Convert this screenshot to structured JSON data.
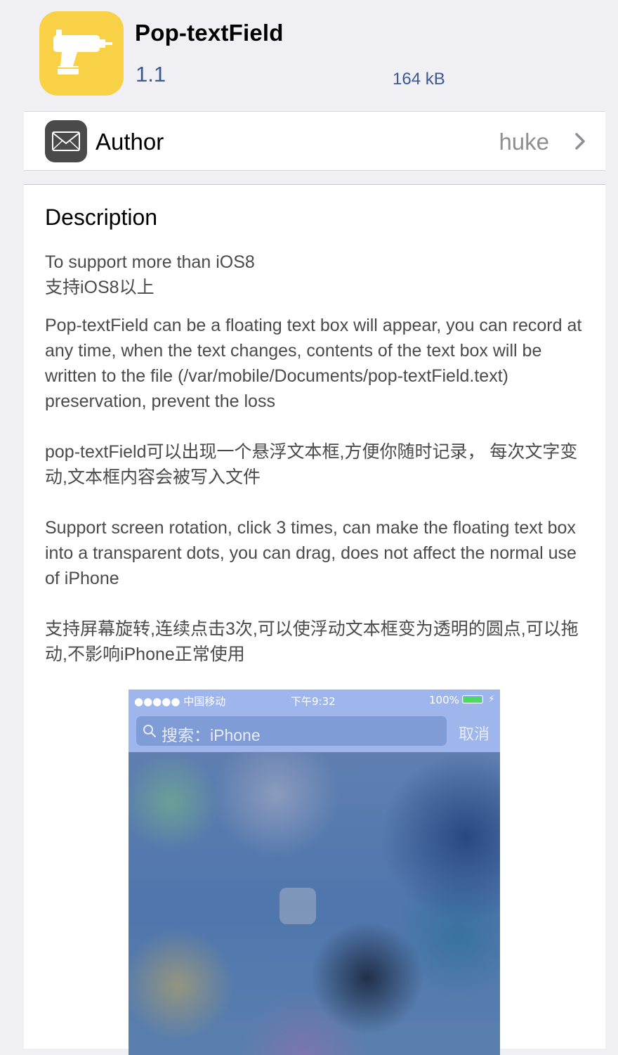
{
  "app": {
    "title": "Pop-textField",
    "version": "1.1",
    "size": "164 kB",
    "icon": "drill-icon",
    "icon_color": "#f9d147"
  },
  "author_row": {
    "label": "Author",
    "value": "huke",
    "icon": "mail-icon",
    "chevron": "chevron-right-icon"
  },
  "description": {
    "heading": "Description",
    "paragraphs": [
      "To support more than iOS8\n支持iOS8以上",
      "Pop-textField can be a floating text box will appear, you can record at any time, when the text changes, contents of the text box will be written to the file (/var/mobile/Documents/pop-textField.text) preservation, prevent the loss",
      "pop-textField可以出现一个悬浮文本框,方便你随时记录， 每次文字变动,文本框内容会被写入文件",
      "Support screen rotation, click 3 times, can make the floating text box into a transparent dots, you can drag, does not affect the normal use of iPhone",
      "支持屏幕旋转,连续点击3次,可以使浮动文本框变为透明的圆点,可以拖动,不影响iPhone正常使用"
    ]
  },
  "screenshot": {
    "status_left": "●●●●● 中国移动",
    "status_time": "下午9:32",
    "status_battery": "100%",
    "search_text": "搜索：iPhone",
    "cancel_label": "取消"
  },
  "colors": {
    "background": "#efeff4",
    "link": "#3b5a93",
    "secondary_text": "#8e8e93"
  }
}
